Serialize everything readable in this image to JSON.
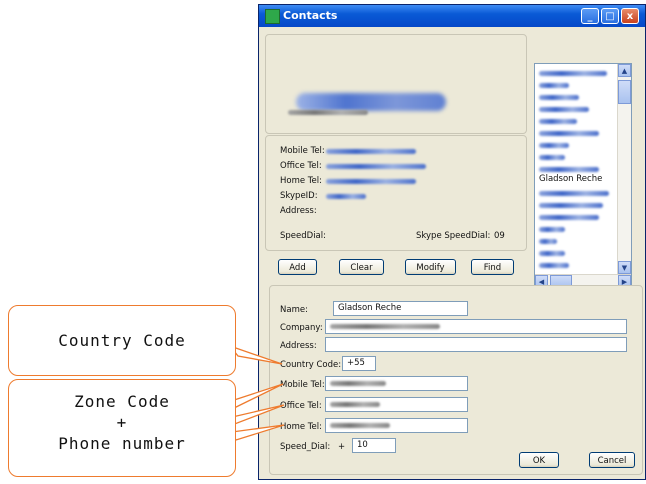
{
  "window": {
    "title": "Contacts",
    "minimize": "_",
    "maximize": "□",
    "close": "x"
  },
  "info": {
    "mobile_label": "Mobile Tel:",
    "office_label": "Office Tel:",
    "home_label": "Home Tel:",
    "skype_label": "SkypeID:",
    "address_label": "Address:",
    "speeddial_label": "SpeedDial:",
    "skype_speeddial_label": "Skype SpeedDial:",
    "skype_speeddial_value": "09"
  },
  "list": {
    "selected_name": "Gladson Reche",
    "scroll_up": "▲",
    "scroll_down": "▼",
    "scroll_left": "◀",
    "scroll_right": "▶"
  },
  "actions": {
    "add": "Add",
    "clear": "Clear",
    "modify": "Modify",
    "find": "Find"
  },
  "form": {
    "name_label": "Name:",
    "name_value": "Gladson Reche",
    "company_label": "Company:",
    "address_label": "Address:",
    "country_code_label": "Country Code:",
    "country_code_value": "+55",
    "mobile_label": "Mobile Tel:",
    "office_label": "Office Tel:",
    "home_label": "Home Tel:",
    "speed_dial_label": "Speed_Dial:",
    "speed_dial_prefix": "+",
    "speed_dial_value": "10",
    "ok": "OK",
    "cancel": "Cancel"
  },
  "callouts": {
    "country_code": "Country Code",
    "zone_line1": "Zone Code",
    "zone_line2": "+",
    "zone_line3": "Phone number"
  },
  "colors": {
    "accent": "#0548c8",
    "callout_border": "#ee7b2e",
    "window_bg": "#ece9d8"
  }
}
